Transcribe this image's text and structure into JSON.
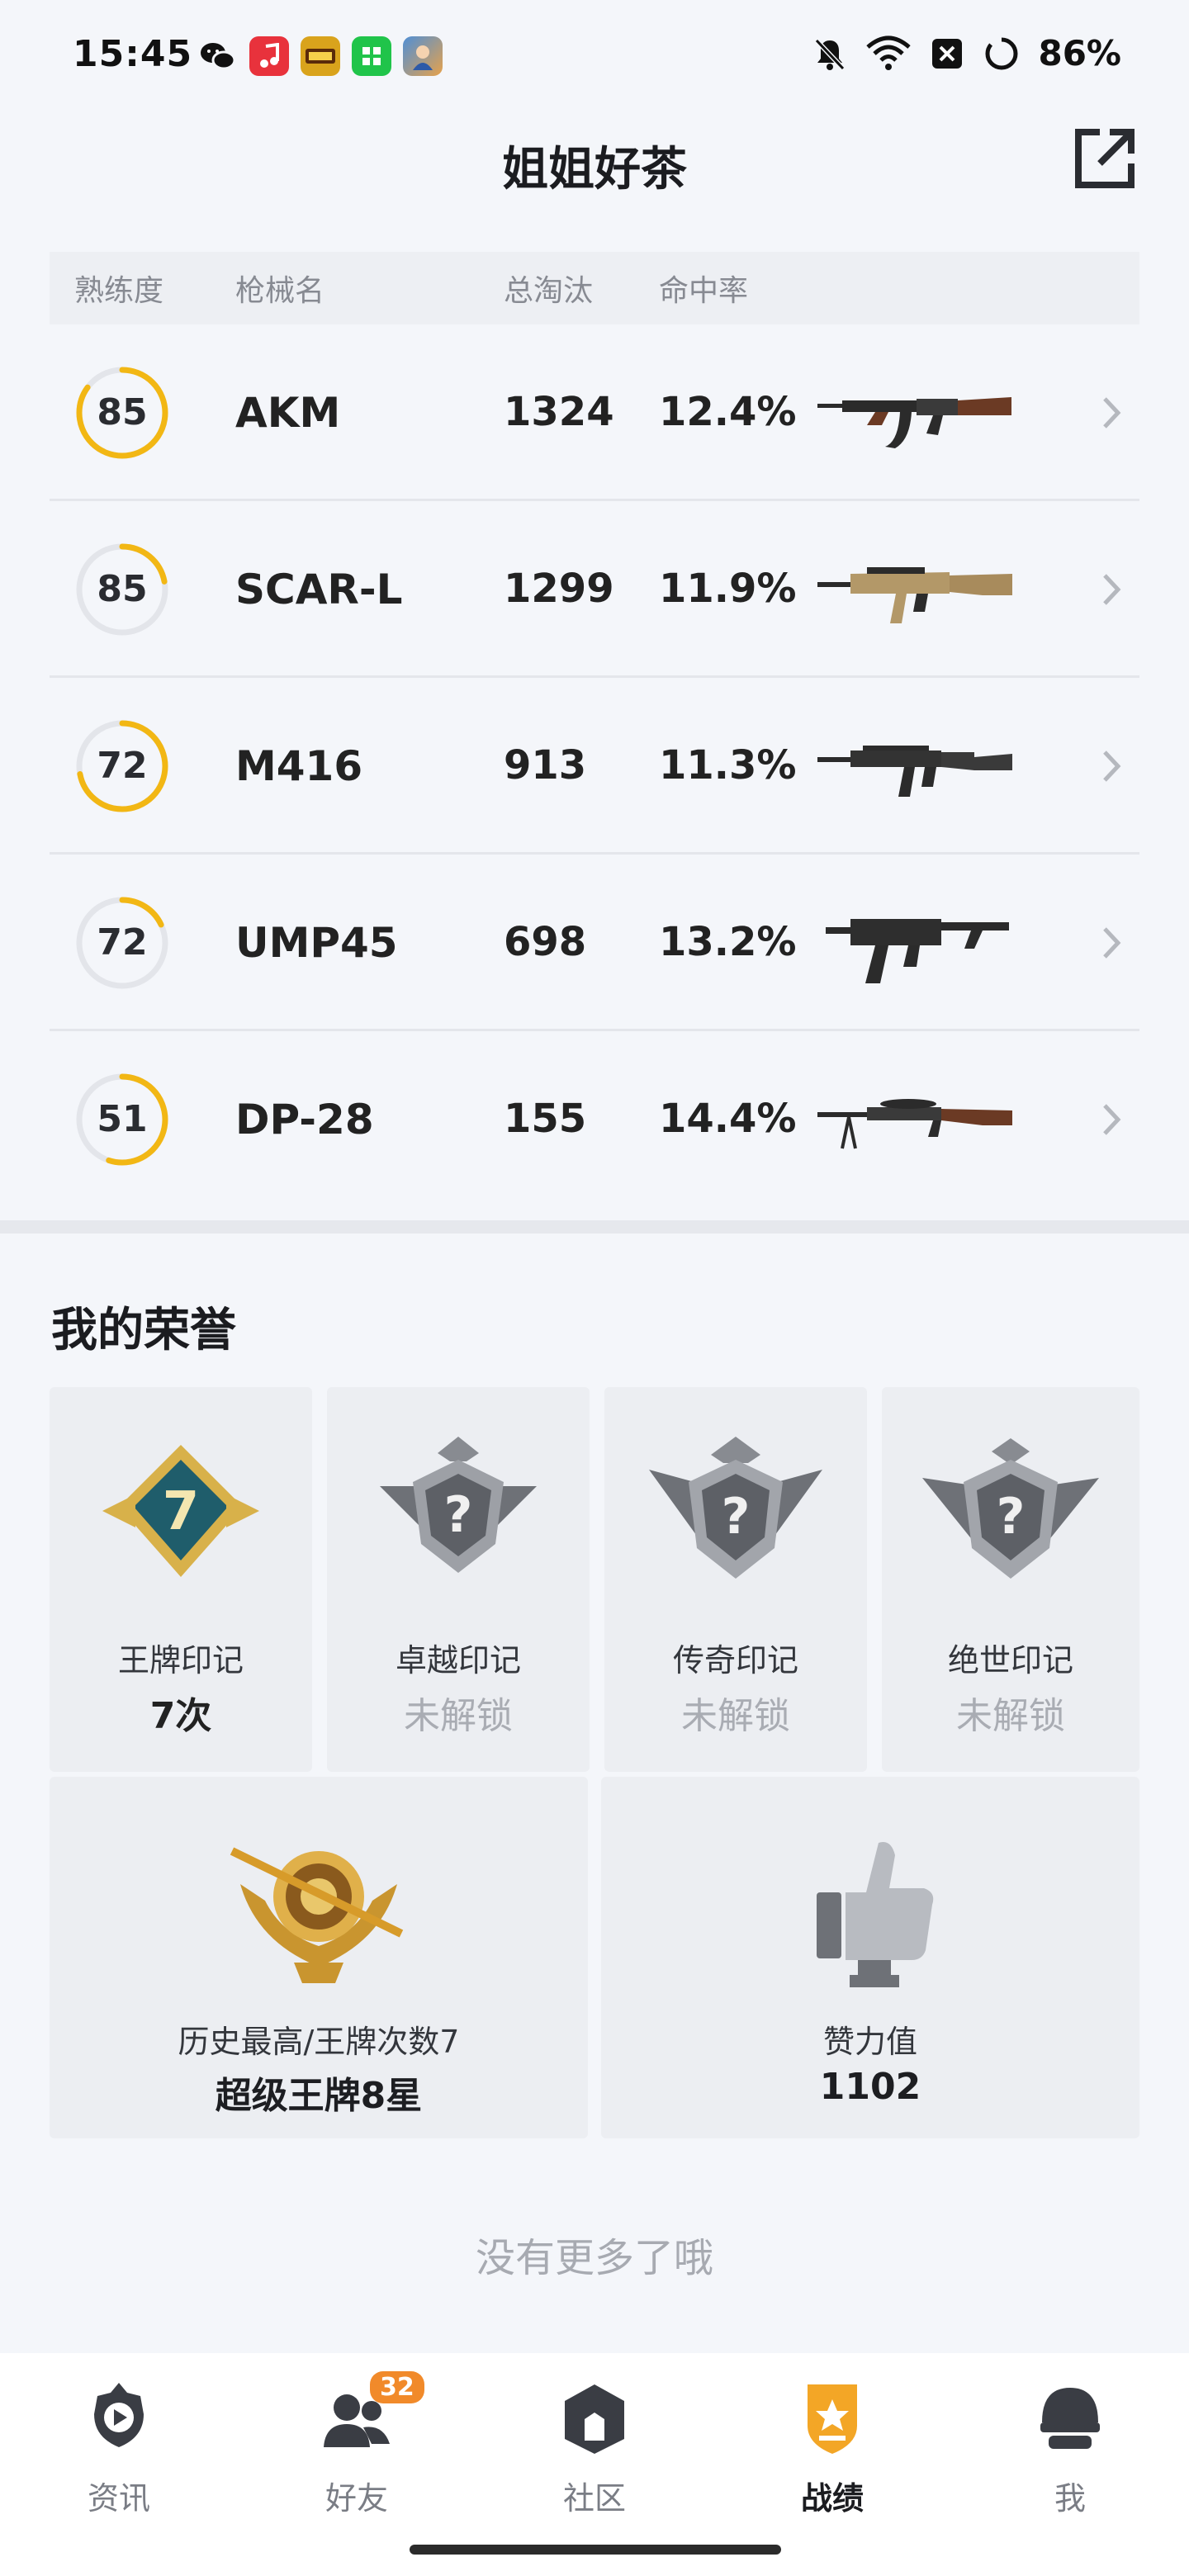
{
  "status_bar": {
    "time": "15:45",
    "battery": "86%",
    "apps": [
      "wechat-icon",
      "music-app-icon",
      "game-app-icon",
      "green-app-icon",
      "game-avatar-icon"
    ]
  },
  "header": {
    "title": "姐姐好茶"
  },
  "table": {
    "columns": [
      "熟练度",
      "枪械名",
      "总淘汰",
      "命中率"
    ],
    "rows": [
      {
        "proficiency": "85",
        "ring_fill": 0.85,
        "ring_color": "#f2b714",
        "name": "AKM",
        "kills": "1324",
        "hit_rate": "12.4%"
      },
      {
        "proficiency": "85",
        "ring_fill": 0.22,
        "ring_color": "#f2b714",
        "name": "SCAR-L",
        "kills": "1299",
        "hit_rate": "11.9%"
      },
      {
        "proficiency": "72",
        "ring_fill": 0.72,
        "ring_color": "#f2b714",
        "name": "M416",
        "kills": "913",
        "hit_rate": "11.3%"
      },
      {
        "proficiency": "72",
        "ring_fill": 0.18,
        "ring_color": "#f2b714",
        "name": "UMP45",
        "kills": "698",
        "hit_rate": "13.2%"
      },
      {
        "proficiency": "51",
        "ring_fill": 0.55,
        "ring_color": "#f2b714",
        "name": "DP-28",
        "kills": "155",
        "hit_rate": "14.4%"
      }
    ]
  },
  "honors": {
    "title": "我的荣誉",
    "cards": [
      {
        "label": "王牌印记",
        "value": "7次",
        "locked": false,
        "badge_text": "7"
      },
      {
        "label": "卓越印记",
        "value": "未解锁",
        "locked": true,
        "badge_text": "?"
      },
      {
        "label": "传奇印记",
        "value": "未解锁",
        "locked": true,
        "badge_text": "?"
      },
      {
        "label": "绝世印记",
        "value": "未解锁",
        "locked": true,
        "badge_text": "?"
      }
    ],
    "big_cards": [
      {
        "label": "历史最高/王牌次数7",
        "value": "超级王牌8星"
      },
      {
        "label": "赞力值",
        "value": "1102"
      }
    ]
  },
  "footer": {
    "no_more": "没有更多了哦"
  },
  "bottom_nav": {
    "items": [
      {
        "label": "资讯",
        "icon": "news-icon",
        "active": false
      },
      {
        "label": "好友",
        "icon": "friends-icon",
        "active": false,
        "badge": "32"
      },
      {
        "label": "社区",
        "icon": "community-icon",
        "active": false
      },
      {
        "label": "战绩",
        "icon": "record-icon",
        "active": true
      },
      {
        "label": "我",
        "icon": "profile-icon",
        "active": false
      }
    ]
  },
  "colors": {
    "accent": "#f2b714",
    "background": "#f4f6fa",
    "badge": "#f18a2a"
  }
}
